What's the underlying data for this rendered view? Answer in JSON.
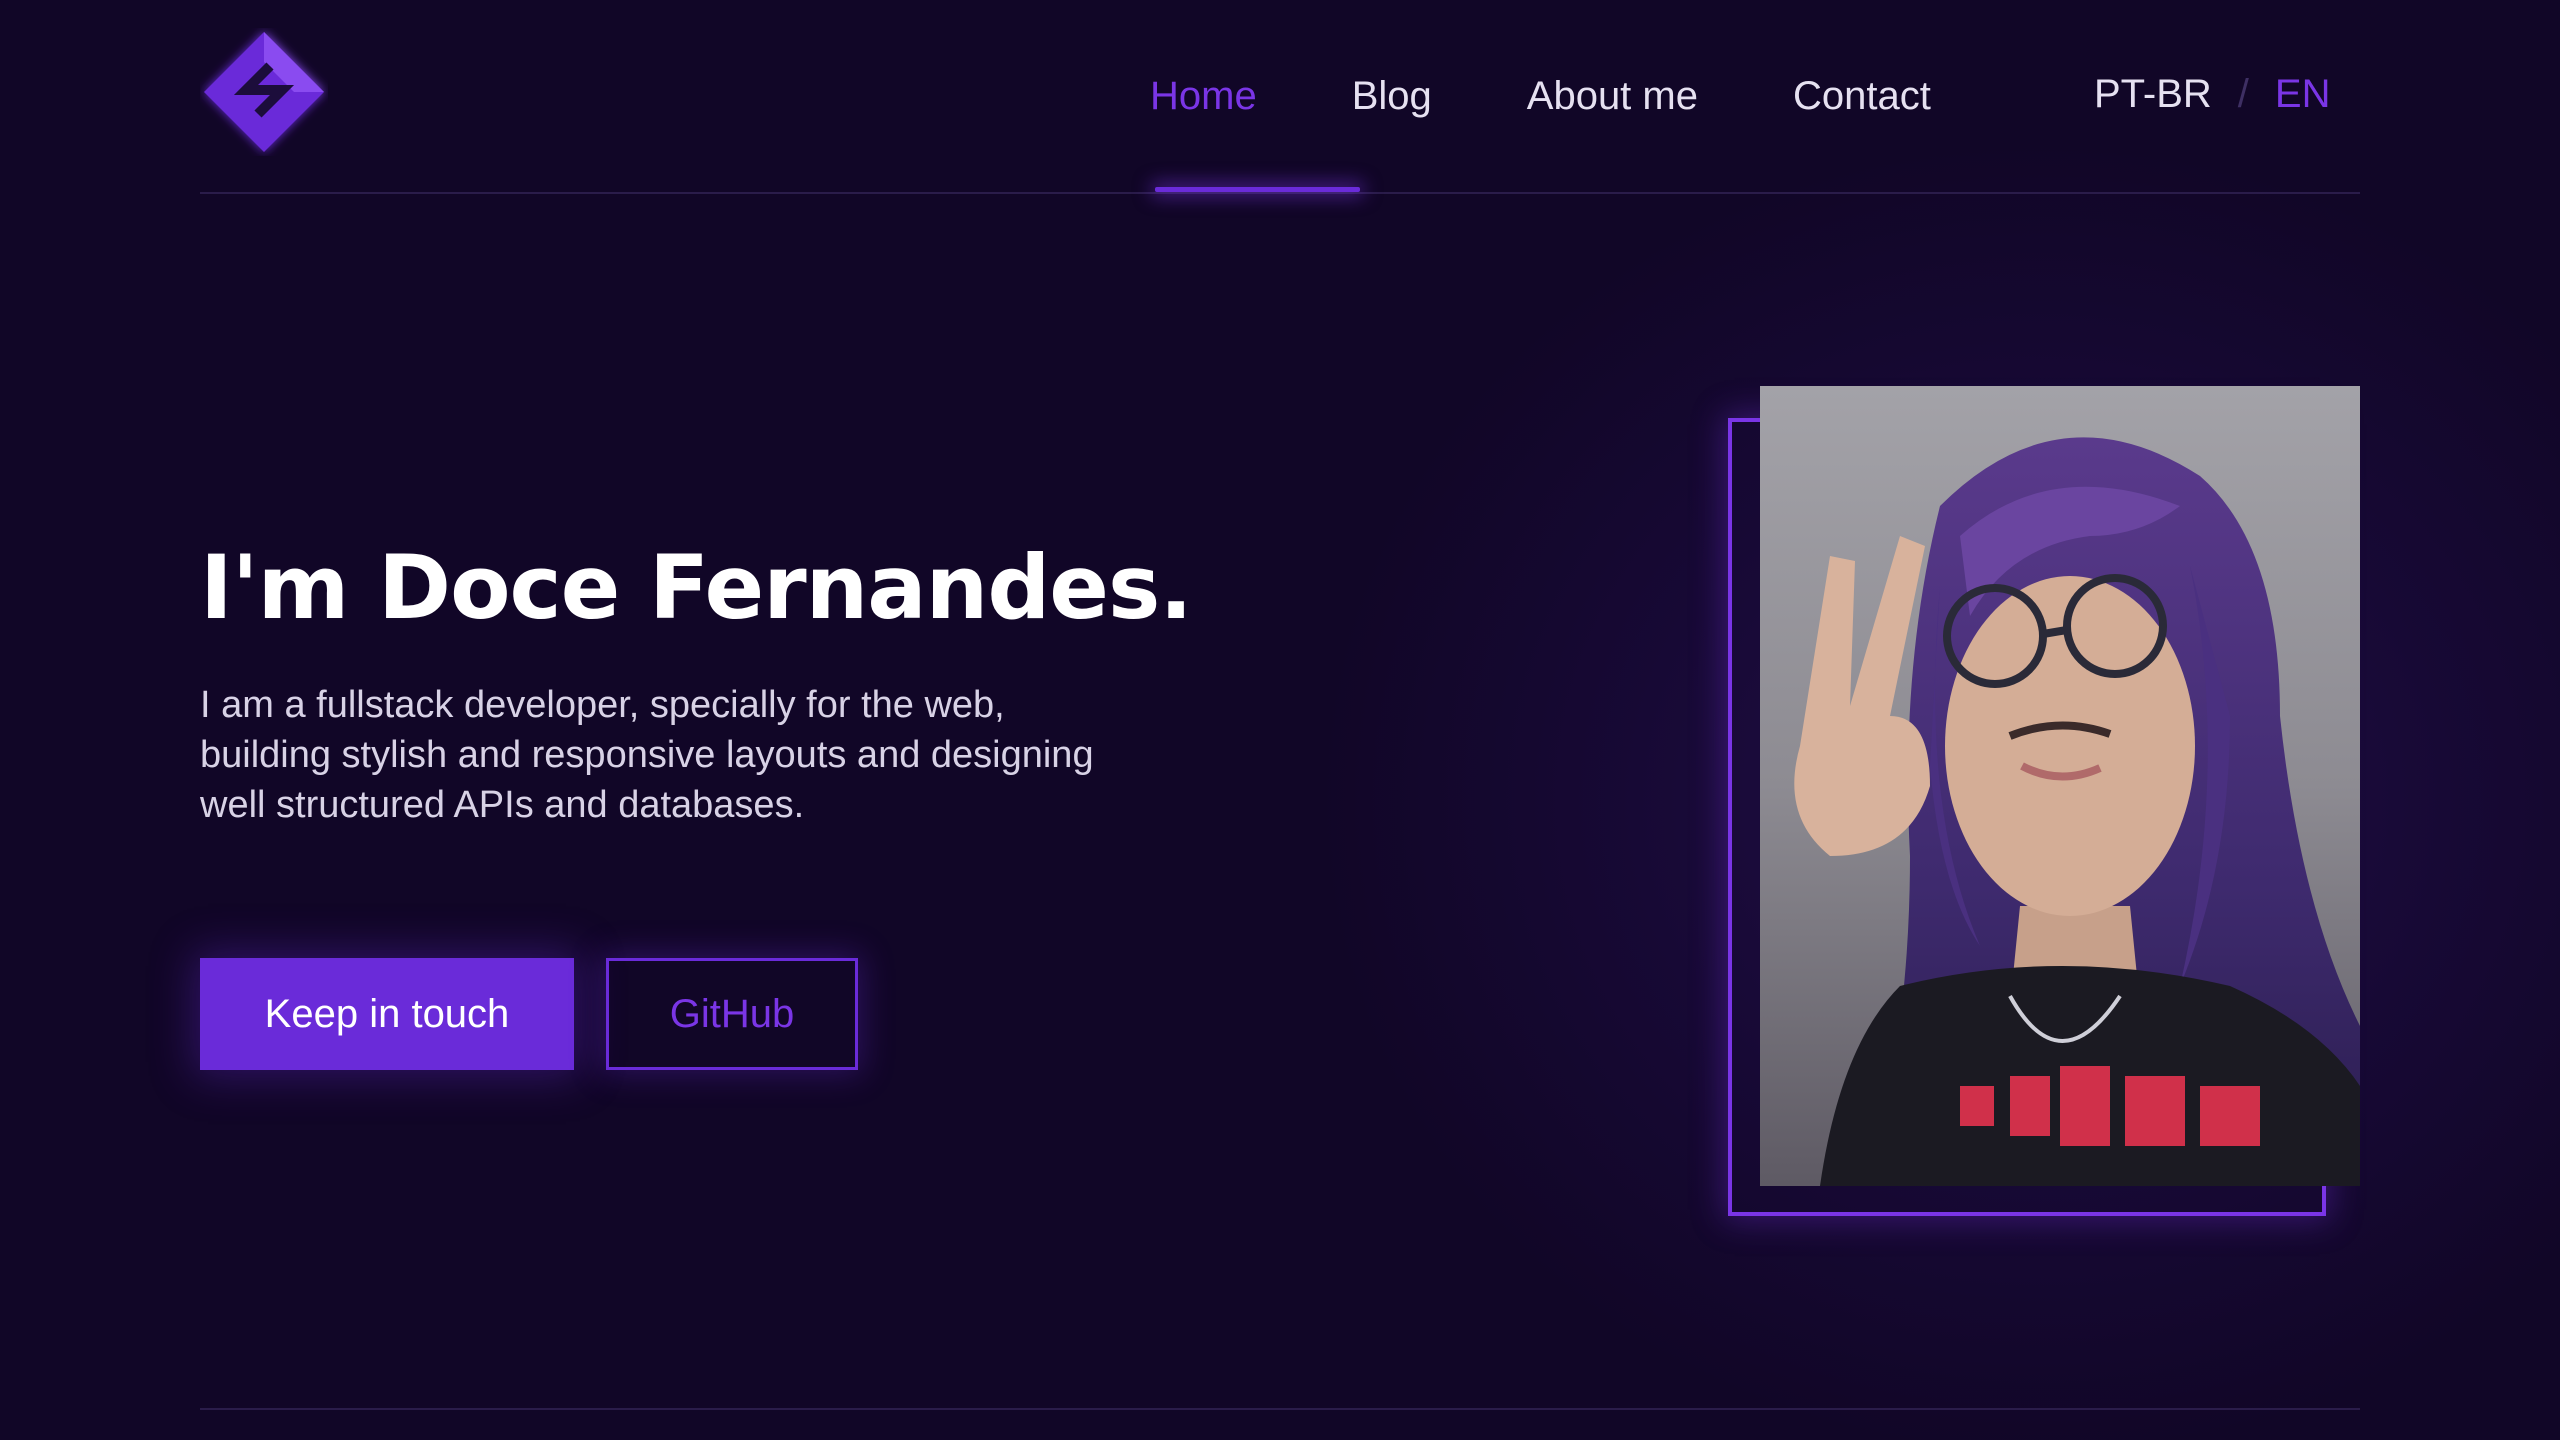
{
  "brand": {
    "logo_icon": "diamond-s-logo-icon",
    "accent_color": "#6a2bd9",
    "background_color": "#110627"
  },
  "nav": {
    "items": [
      {
        "label": "Home",
        "active": true
      },
      {
        "label": "Blog",
        "active": false
      },
      {
        "label": "About me",
        "active": false
      },
      {
        "label": "Contact",
        "active": false
      }
    ],
    "language": {
      "option_ptbr": "PT-BR",
      "separator": "/",
      "option_en": "EN",
      "selected": "EN"
    }
  },
  "hero": {
    "title": "I'm Doce Fernandes.",
    "description": "I am a fullstack developer, specially for the web, building stylish and responsive layouts and designing well structured APIs and databases.",
    "primary_button": "Keep in touch",
    "secondary_button": "GitHub"
  },
  "portrait": {
    "icon": "profile-photo"
  }
}
